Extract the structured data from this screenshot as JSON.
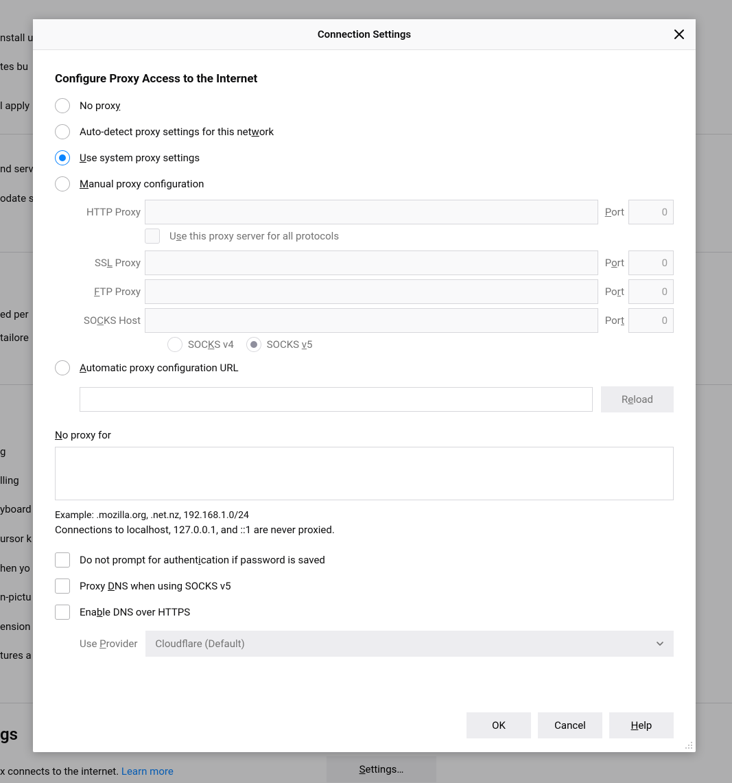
{
  "bg": {
    "t1": "nstall u",
    "t2": "tes bu",
    "t3": "l apply",
    "t4": "nd serv",
    "t5": "odate s",
    "t6": "ed per",
    "t7": "tailore",
    "t8": "g",
    "t9": "lling",
    "t10": "yboard",
    "t11": "ursor k",
    "t12": "hen yo",
    "t13": "n-pictu",
    "t14": "ension",
    "t15": "tures a",
    "t16": "gs",
    "t17": "x connects to the internet. ",
    "t18": "Learn more",
    "settings_btn": "Settings…"
  },
  "dialog": {
    "title": "Connection Settings",
    "heading": "Configure Proxy Access to the Internet",
    "radios": {
      "no_proxy": "No proxy",
      "auto_detect_pre": "Auto-detect proxy settings for this net",
      "auto_detect_u": "w",
      "auto_detect_post": "ork",
      "use_system_u": "U",
      "use_system_post": "se system proxy settings",
      "manual_u": "M",
      "manual_post": "anual proxy configuration",
      "auto_url_u": "A",
      "auto_url_post": "utomatic proxy configuration URL"
    },
    "proxy": {
      "http_label": "HTTP Proxy",
      "ssl_label_pre": "SS",
      "ssl_label_u": "L",
      "ssl_label_post": " Proxy",
      "ftp_label_u": "F",
      "ftp_label_post": "TP Proxy",
      "socks_label_pre": "SO",
      "socks_label_u": "C",
      "socks_label_post": "KS Host",
      "port_label_u": "P",
      "port_label_post": "ort",
      "port_label2_pre": "P",
      "port_label2_u": "o",
      "port_label2_post": "rt",
      "port_label3_pre": "Po",
      "port_label3_u": "r",
      "port_label3_post": "t",
      "port_label4_pre": "Por",
      "port_label4_u": "t",
      "port_value": "0",
      "use_all_pre": "U",
      "use_all_u": "s",
      "use_all_post": "e this proxy server for all protocols",
      "socks4_pre": "SOC",
      "socks4_u": "K",
      "socks4_post": "S v4",
      "socks5_pre": "SOCKS ",
      "socks5_u": "v",
      "socks5_post": "5"
    },
    "reload_pre": "R",
    "reload_u": "e",
    "reload_post": "load",
    "noproxy_label_u": "N",
    "noproxy_label_post": "o proxy for",
    "example": "Example: .mozilla.org, .net.nz, 192.168.1.0/24",
    "localhost_note": "Connections to localhost, 127.0.0.1, and ::1 are never proxied.",
    "chk_noprompt_pre": "Do not prompt for authent",
    "chk_noprompt_u": "i",
    "chk_noprompt_post": "cation if password is saved",
    "chk_proxydns_pre": "Proxy ",
    "chk_proxydns_u": "D",
    "chk_proxydns_post": "NS when using SOCKS v5",
    "chk_doh_pre": "Ena",
    "chk_doh_u": "b",
    "chk_doh_post": "le DNS over HTTPS",
    "provider_label_pre": "Use ",
    "provider_label_u": "P",
    "provider_label_post": "rovider",
    "provider_value": "Cloudflare (Default)",
    "ok": "OK",
    "cancel": "Cancel",
    "help_u": "H",
    "help_post": "elp"
  }
}
